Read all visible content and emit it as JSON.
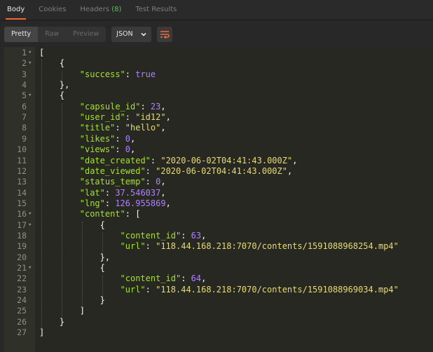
{
  "tabs": [
    {
      "label": "Body",
      "active": true
    },
    {
      "label": "Cookies",
      "active": false
    },
    {
      "label": "Headers",
      "count": "(8)",
      "active": false
    },
    {
      "label": "Test Results",
      "active": false
    }
  ],
  "toolbar": {
    "views": [
      {
        "label": "Pretty",
        "active": true
      },
      {
        "label": "Raw",
        "active": false
      },
      {
        "label": "Preview",
        "active": false
      }
    ],
    "format": "JSON",
    "wrap_icon": "wrap-lines-icon"
  },
  "accent": "#f26b3a",
  "lines": [
    {
      "n": "1",
      "fold": true,
      "indent": 0,
      "tokens": [
        [
          "p",
          "["
        ]
      ]
    },
    {
      "n": "2",
      "fold": true,
      "indent": 1,
      "tokens": [
        [
          "p",
          "{"
        ]
      ]
    },
    {
      "n": "3",
      "fold": false,
      "indent": 2,
      "tokens": [
        [
          "key",
          "\"success\""
        ],
        [
          "p",
          ": "
        ],
        [
          "kw",
          "true"
        ]
      ]
    },
    {
      "n": "4",
      "fold": false,
      "indent": 1,
      "tokens": [
        [
          "p",
          "},"
        ]
      ]
    },
    {
      "n": "5",
      "fold": true,
      "indent": 1,
      "tokens": [
        [
          "p",
          "{"
        ]
      ]
    },
    {
      "n": "6",
      "fold": false,
      "indent": 2,
      "tokens": [
        [
          "key",
          "\"capsule_id\""
        ],
        [
          "p",
          ": "
        ],
        [
          "num",
          "23"
        ],
        [
          "p",
          ","
        ]
      ]
    },
    {
      "n": "7",
      "fold": false,
      "indent": 2,
      "tokens": [
        [
          "key",
          "\"user_id\""
        ],
        [
          "p",
          ": "
        ],
        [
          "str",
          "\"id12\""
        ],
        [
          "p",
          ","
        ]
      ]
    },
    {
      "n": "8",
      "fold": false,
      "indent": 2,
      "tokens": [
        [
          "key",
          "\"title\""
        ],
        [
          "p",
          ": "
        ],
        [
          "str",
          "\"hello\""
        ],
        [
          "p",
          ","
        ]
      ]
    },
    {
      "n": "9",
      "fold": false,
      "indent": 2,
      "tokens": [
        [
          "key",
          "\"likes\""
        ],
        [
          "p",
          ": "
        ],
        [
          "num",
          "0"
        ],
        [
          "p",
          ","
        ]
      ]
    },
    {
      "n": "10",
      "fold": false,
      "indent": 2,
      "tokens": [
        [
          "key",
          "\"views\""
        ],
        [
          "p",
          ": "
        ],
        [
          "num",
          "0"
        ],
        [
          "p",
          ","
        ]
      ]
    },
    {
      "n": "11",
      "fold": false,
      "indent": 2,
      "tokens": [
        [
          "key",
          "\"date_created\""
        ],
        [
          "p",
          ": "
        ],
        [
          "str",
          "\"2020-06-02T04:41:43.000Z\""
        ],
        [
          "p",
          ","
        ]
      ]
    },
    {
      "n": "12",
      "fold": false,
      "indent": 2,
      "tokens": [
        [
          "key",
          "\"date_viewed\""
        ],
        [
          "p",
          ": "
        ],
        [
          "str",
          "\"2020-06-02T04:41:43.000Z\""
        ],
        [
          "p",
          ","
        ]
      ]
    },
    {
      "n": "13",
      "fold": false,
      "indent": 2,
      "tokens": [
        [
          "key",
          "\"status_temp\""
        ],
        [
          "p",
          ": "
        ],
        [
          "num",
          "0"
        ],
        [
          "p",
          ","
        ]
      ]
    },
    {
      "n": "14",
      "fold": false,
      "indent": 2,
      "tokens": [
        [
          "key",
          "\"lat\""
        ],
        [
          "p",
          ": "
        ],
        [
          "num",
          "37.546037"
        ],
        [
          "p",
          ","
        ]
      ]
    },
    {
      "n": "15",
      "fold": false,
      "indent": 2,
      "tokens": [
        [
          "key",
          "\"lng\""
        ],
        [
          "p",
          ": "
        ],
        [
          "num",
          "126.955869"
        ],
        [
          "p",
          ","
        ]
      ]
    },
    {
      "n": "16",
      "fold": true,
      "indent": 2,
      "tokens": [
        [
          "key",
          "\"content\""
        ],
        [
          "p",
          ": ["
        ]
      ]
    },
    {
      "n": "17",
      "fold": true,
      "indent": 3,
      "tokens": [
        [
          "p",
          "{"
        ]
      ]
    },
    {
      "n": "18",
      "fold": false,
      "indent": 4,
      "tokens": [
        [
          "key",
          "\"content_id\""
        ],
        [
          "p",
          ": "
        ],
        [
          "num",
          "63"
        ],
        [
          "p",
          ","
        ]
      ]
    },
    {
      "n": "19",
      "fold": false,
      "indent": 4,
      "tokens": [
        [
          "key",
          "\"url\""
        ],
        [
          "p",
          ": "
        ],
        [
          "str",
          "\"118.44.168.218:7070/contents/1591088968254.mp4\""
        ]
      ]
    },
    {
      "n": "20",
      "fold": false,
      "indent": 3,
      "tokens": [
        [
          "p",
          "},"
        ]
      ]
    },
    {
      "n": "21",
      "fold": true,
      "indent": 3,
      "tokens": [
        [
          "p",
          "{"
        ]
      ]
    },
    {
      "n": "22",
      "fold": false,
      "indent": 4,
      "tokens": [
        [
          "key",
          "\"content_id\""
        ],
        [
          "p",
          ": "
        ],
        [
          "num",
          "64"
        ],
        [
          "p",
          ","
        ]
      ]
    },
    {
      "n": "23",
      "fold": false,
      "indent": 4,
      "tokens": [
        [
          "key",
          "\"url\""
        ],
        [
          "p",
          ": "
        ],
        [
          "str",
          "\"118.44.168.218:7070/contents/1591088969034.mp4\""
        ]
      ]
    },
    {
      "n": "24",
      "fold": false,
      "indent": 3,
      "tokens": [
        [
          "p",
          "}"
        ]
      ]
    },
    {
      "n": "25",
      "fold": false,
      "indent": 2,
      "tokens": [
        [
          "p",
          "]"
        ]
      ]
    },
    {
      "n": "26",
      "fold": false,
      "indent": 1,
      "tokens": [
        [
          "p",
          "}"
        ]
      ]
    },
    {
      "n": "27",
      "fold": false,
      "indent": 0,
      "tokens": [
        [
          "p",
          "]"
        ]
      ]
    }
  ]
}
